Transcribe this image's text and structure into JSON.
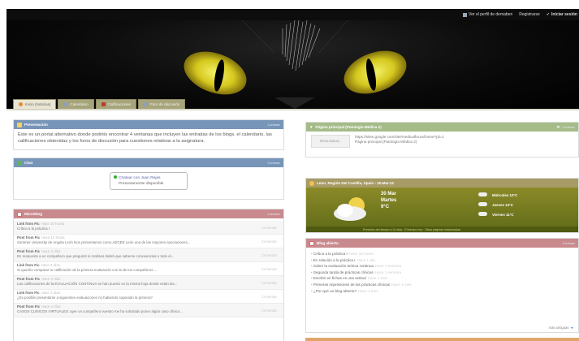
{
  "topbar": {
    "profile_link": "Ver el perfil de demaben",
    "register_link": "Registrarse",
    "login_link": "Iniciar sesión"
  },
  "tabs": [
    {
      "label": "Inicio (Noticias)",
      "icon": "home-icon",
      "color": "#e88b2e"
    },
    {
      "label": "Calendario",
      "icon": "calendar-icon",
      "color": "#8fa0b8"
    },
    {
      "label": "Calificaciones",
      "icon": "grades-icon",
      "color": "#c0392b"
    },
    {
      "label": "Foro de discusión",
      "icon": "forum-icon",
      "color": "#8fa0b8"
    }
  ],
  "presentacion": {
    "title": "Presentación",
    "action": "Contraer",
    "text": "Este es un portal alternativo donde podréis encontrar 4 ventanas que incluyen las entradas de los blogs, el calendario, las calificaciones obtenidas y los foros de discusión para cuestiones relativas a la asignatura."
  },
  "chat": {
    "title": "Chat",
    "action": "Contraer",
    "link": "Chatear con Juan Rejas",
    "status": "Presuntamente disponible"
  },
  "microblog": {
    "title": "Microblog",
    "action": "Contraer",
    "items": [
      {
        "title": "Link from Fic",
        "date": "Hace 10 horas",
        "text": "Crítica a la práctica I",
        "comment": "Comentar"
      },
      {
        "title": "Post from Fic",
        "date": "Hace 10 horas",
        "text": "Summer University de Angela León Nos presentamos como AEGEE León una de las mayores asociaciones...",
        "comment": "Comentar"
      },
      {
        "title": "Post from Fic",
        "date": "Hace 3 días",
        "text": "En respuesta a un compañero que preguntó si mañana habrá que saberse convivencias o todo el...",
        "comment": "Comentar"
      },
      {
        "title": "Link from Fic",
        "date": "Hace 3 días",
        "text": "Si queréis comparar tu calificación de la primera evaluación con la de tus compañeros ...",
        "comment": "Comentar"
      },
      {
        "title": "Post from Fic",
        "date": "Hace 3 días",
        "text": "Las calificaciones de la EVALUACIÓN CONTINUA se han puesto en la misma hoja donde están las...",
        "comment": "Comentar"
      },
      {
        "title": "Link from Fic",
        "date": "Hace 3 días",
        "text": "¿Es posible presentarse a siguientes evaluaciones no habiendo superado la primera?",
        "comment": "Comentar"
      },
      {
        "title": "Post from Fic",
        "date": "Hace 4 días",
        "text": "CASOS CLÍNICOS VIRTUALES: ayer un compañero vuestro me ha solicitado poner algún caso clínico...",
        "comment": "Comentar"
      }
    ]
  },
  "pagina": {
    "title": "Página principal (Patología Médica 2)",
    "action": "Contraer",
    "thumb": "PATOLOGÍA M...",
    "url": "https://sites.google.com/site/medicalfocus/home?pli=1",
    "subtitle": "Página principal (Patología Médica 2)"
  },
  "tiempo": {
    "title": "Leon, Región Del Castilla, Spain - 30.Mar.12",
    "date": "30 Mar",
    "day": "Martes",
    "temp": "9°C",
    "forecast": [
      {
        "day": "Miércoles",
        "temp": "12°C"
      },
      {
        "day": "Jueves",
        "temp": "13°C"
      },
      {
        "day": "Viernes",
        "temp": "11°C"
      }
    ],
    "footer": "Previsión del tiempo a 14 días · El tiempo hoy · Otras páginas relacionadas"
  },
  "blogs": {
    "title": "Blog abierto",
    "action": "Contraer",
    "items": [
      {
        "text": "Crítica a la práctica I",
        "date": "Hace 10 horas"
      },
      {
        "text": "En relación a la práctica I",
        "date": "Hace 1 día"
      },
      {
        "text": "Sobre la evaluación teórica continua",
        "date": "Hace 1 semana"
      },
      {
        "text": "Segunda tanda de prácticas clínicas",
        "date": "Hace 1 semana"
      },
      {
        "text": "Escribir en fichas es una actitud",
        "date": "Hace 1 mes"
      },
      {
        "text": "Primeras impresiones de las prácticas clínicas",
        "date": "Hace 1 mes"
      },
      {
        "text": "¿Por qué un blog abierto?",
        "date": "Hace 1 mes"
      }
    ],
    "more": "más antiguas"
  },
  "colors": {
    "header_bg": "#000000",
    "tab_bg": "#a6a47a",
    "blue_head": "#7795b8",
    "green_head": "#a5bc89",
    "red_head": "#c98a8e"
  }
}
